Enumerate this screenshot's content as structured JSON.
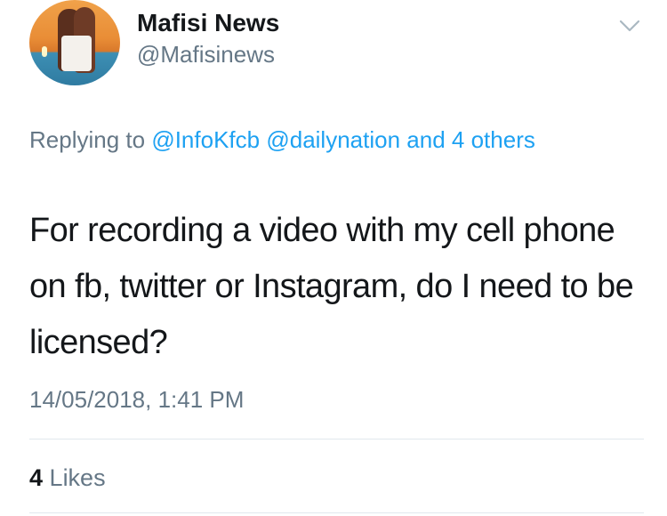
{
  "user": {
    "name": "Mafisi News",
    "handle": "@Mafisinews"
  },
  "reply": {
    "prefix": "Replying to",
    "mention1": "@InfoKfcb",
    "mention2": "@dailynation",
    "others": "and 4 others"
  },
  "tweet": {
    "text": "For recording a video with my cell phone on fb, twitter or Instagram, do I need to be licensed?",
    "timestamp": "14/05/2018, 1:41 PM"
  },
  "stats": {
    "likes_count": "4",
    "likes_label": "Likes"
  },
  "icons": {
    "menu": "chevron-down-icon"
  },
  "colors": {
    "accent": "#1da1f2",
    "secondary_text": "#657786",
    "primary_text": "#14171a"
  }
}
